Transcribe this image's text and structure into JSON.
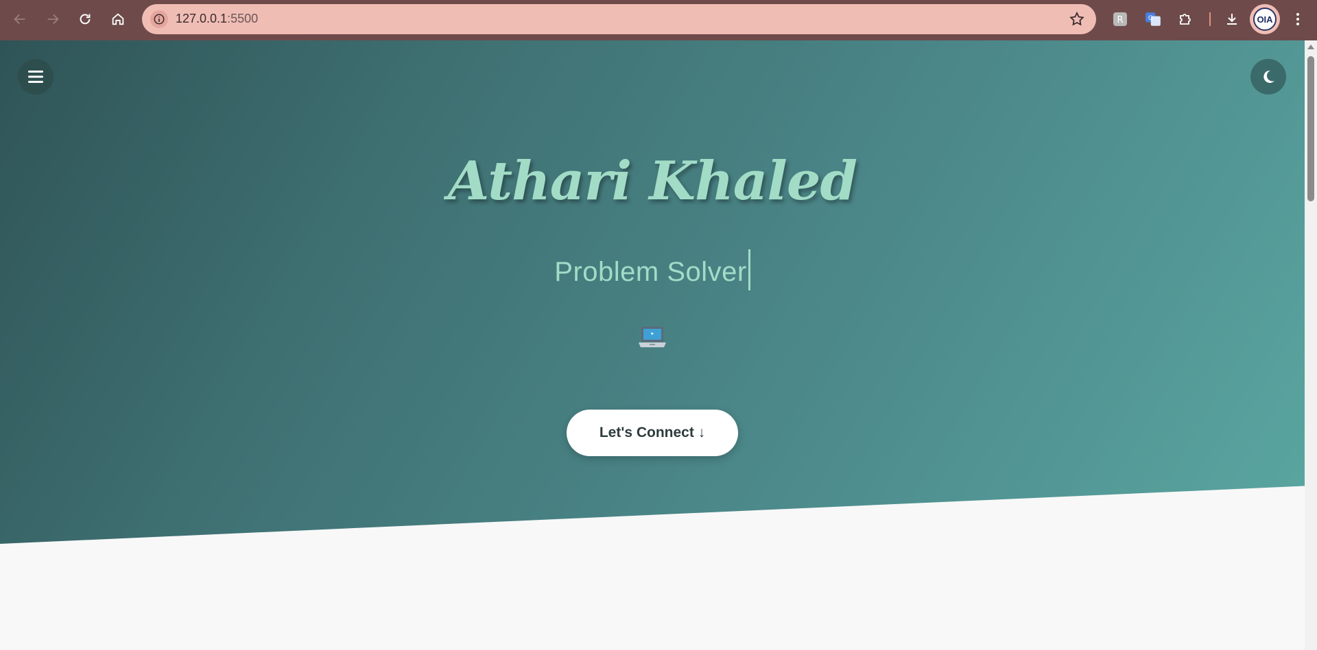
{
  "browser": {
    "url_host": "127.0.0.1",
    "url_port": ":5500",
    "icons": [
      "back-icon",
      "forward-icon",
      "reload-icon",
      "home-icon",
      "site-info-icon",
      "bookmark-star-icon",
      "extension-icon",
      "translate-icon",
      "extensions-puzzle-icon",
      "download-icon",
      "profile-avatar",
      "kebab-menu-icon"
    ],
    "profile_label": "OIA"
  },
  "header": {
    "menu_icon": "hamburger-icon",
    "theme_icon": "moon-icon"
  },
  "hero": {
    "name": "Athari Khaled",
    "role": "Problem Solver",
    "emoji": "laptop-icon",
    "cta_label": "Let's Connect ↓"
  },
  "colors": {
    "accent_text": "#a2dcc7",
    "hero_gradient_start": "#2f5457",
    "hero_gradient_end": "#5aa6a1",
    "chrome_bg": "#6e4b4a",
    "omnibox_bg": "#f0bdb5"
  }
}
